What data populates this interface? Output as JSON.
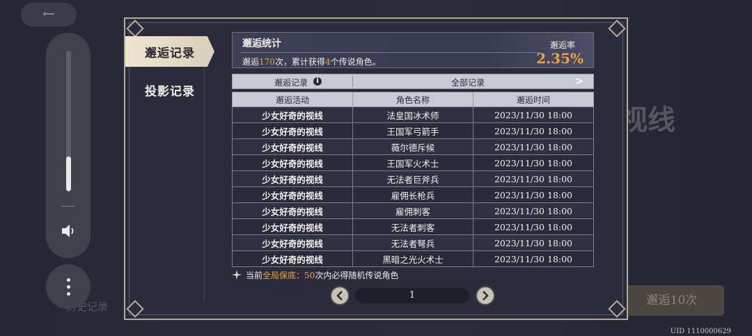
{
  "background": {
    "back_icon": "←",
    "title": "视线",
    "button": "邂逅10次",
    "tab": "历史记录"
  },
  "uid": "UID 1110000629",
  "volume": {
    "level": 0.25
  },
  "tabs": [
    {
      "label": "邂逅记录",
      "active": true
    },
    {
      "label": "投影记录",
      "active": false
    }
  ],
  "stats": {
    "title": "邂逅统计",
    "desc_prefix": "邂逅",
    "count": "170",
    "desc_mid": "次，累计获得",
    "legend_count": "4",
    "desc_suffix": "个传说角色。",
    "rate_label": "邂逅率",
    "rate_value": "2.35%"
  },
  "filter": {
    "label": "邂逅记录",
    "value": "全部记录"
  },
  "table": {
    "headers": [
      "邂逅活动",
      "角色名称",
      "邂逅时间"
    ],
    "rows": [
      [
        "少女好奇的视线",
        "法皇国冰术师",
        "2023/11/30 18:00"
      ],
      [
        "少女好奇的视线",
        "王国军弓箭手",
        "2023/11/30 18:00"
      ],
      [
        "少女好奇的视线",
        "薇尔德斥候",
        "2023/11/30 18:00"
      ],
      [
        "少女好奇的视线",
        "王国军火术士",
        "2023/11/30 18:00"
      ],
      [
        "少女好奇的视线",
        "无法者巨斧兵",
        "2023/11/30 18:00"
      ],
      [
        "少女好奇的视线",
        "雇佣长枪兵",
        "2023/11/30 18:00"
      ],
      [
        "少女好奇的视线",
        "雇佣刺客",
        "2023/11/30 18:00"
      ],
      [
        "少女好奇的视线",
        "无法者刺客",
        "2023/11/30 18:00"
      ],
      [
        "少女好奇的视线",
        "无法者弩兵",
        "2023/11/30 18:00"
      ],
      [
        "少女好奇的视线",
        "黑暗之光火术士",
        "2023/11/30 18:00"
      ]
    ]
  },
  "pity": {
    "prefix": "当前",
    "highlight": "全局保底：",
    "count": "50",
    "suffix": "次内必得随机传说角色"
  },
  "pager": {
    "page": "1"
  },
  "colors": {
    "accent": "#f0a53a",
    "frame": "#b6ac95",
    "panel": "#2a2c3c"
  }
}
